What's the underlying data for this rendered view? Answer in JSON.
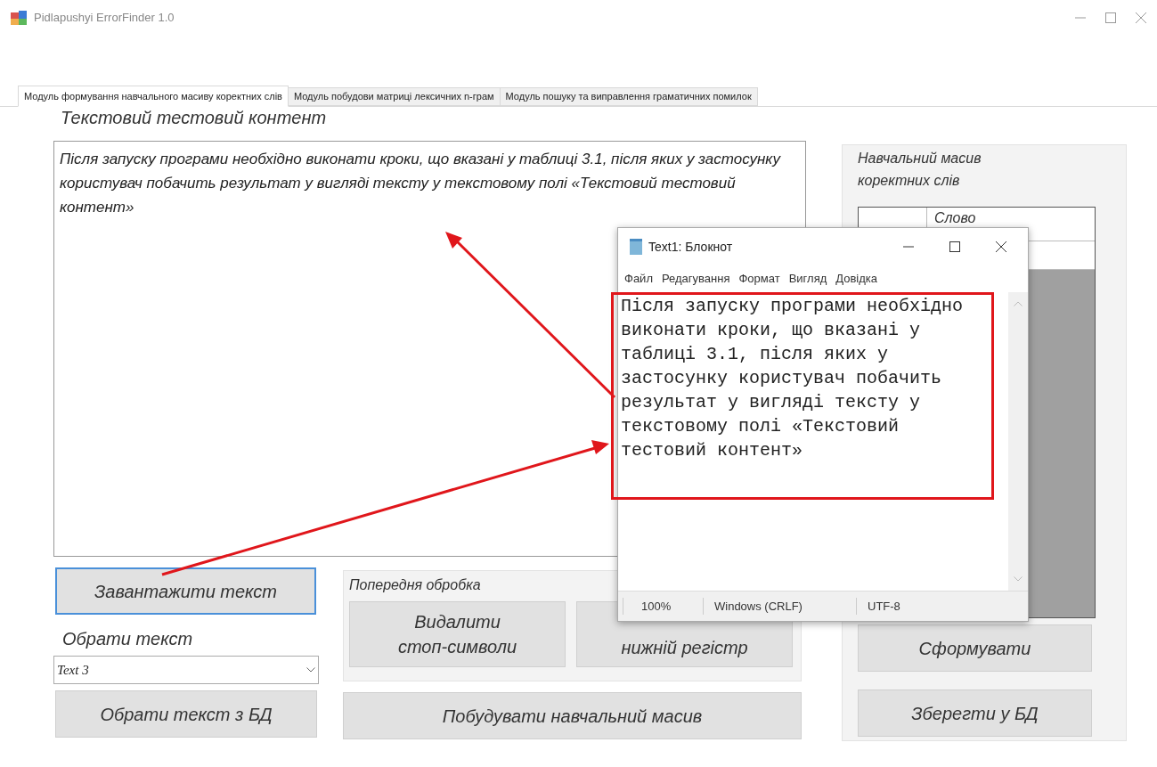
{
  "window": {
    "title": "Pidlapushyi ErrorFinder 1.0"
  },
  "tabs": [
    {
      "label": "Модуль формування навчального масиву коректних слів",
      "selected": true
    },
    {
      "label": "Модуль побудови матриці лексичних n-грам",
      "selected": false
    },
    {
      "label": "Модуль пошуку та виправлення граматичних помилок",
      "selected": false
    }
  ],
  "text_content": {
    "label": "Текстовий тестовий контент",
    "value": "Після запуску програми необхідно виконати кроки, що вказані у таблиці 3.1, після яких у застосунку користувач побачить результат у вигляді тексту у текстовому полі «Текстовий тестовий контент»"
  },
  "load_button": {
    "label": "Завантажити текст",
    "focused": true
  },
  "select_text": {
    "label": "Обрати текст",
    "value": "Text 3"
  },
  "select_db_button": "Обрати текст з БД",
  "preprocessing": {
    "title": "Попередня обробка",
    "buttons": [
      "Видалити\nстоп-символи",
      "нижній регістр"
    ]
  },
  "build_button": "Побудувати навчальний масив",
  "training_array": {
    "title": "Навчальний масив коректних слів",
    "columns": [
      "Слово"
    ],
    "buttons": [
      "Сформувати",
      "Зберегти у БД"
    ]
  },
  "notepad": {
    "title": "Text1: Блокнот",
    "menu": [
      "Файл",
      "Редагування",
      "Формат",
      "Вигляд",
      "Довідка"
    ],
    "text": "Після запуску програми необхідно виконати кроки, що вказані у таблиці 3.1, після яких у застосунку користувач побачить результат у вигляді тексту у текстовому полі «Текстовий тестовий контент»",
    "status": [
      "100%",
      "Windows (CRLF)",
      "UTF-8"
    ]
  }
}
